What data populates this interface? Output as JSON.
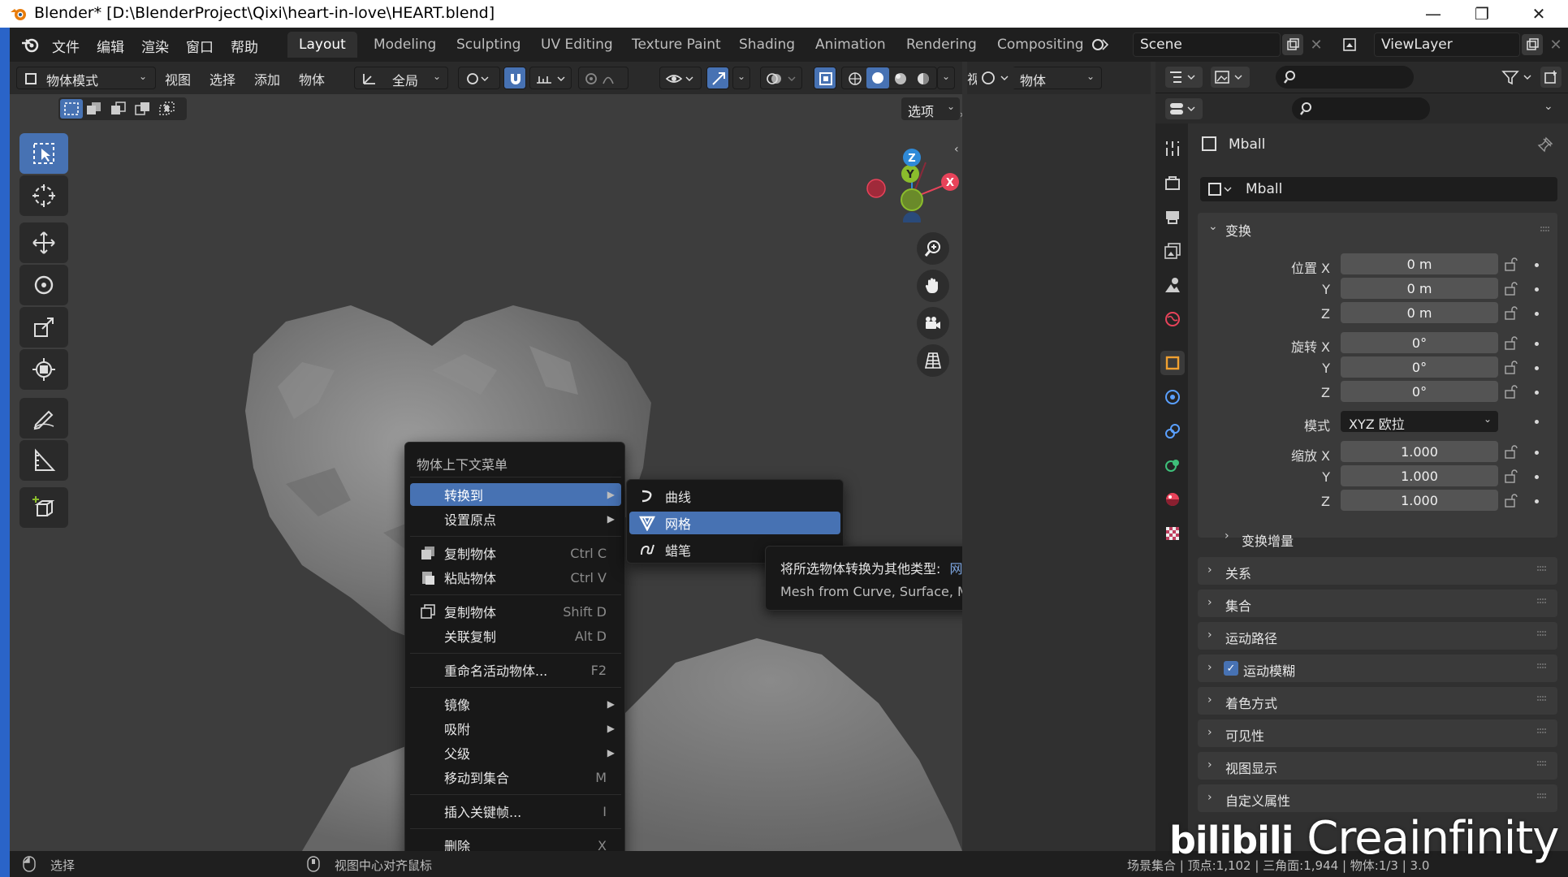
{
  "window": {
    "title": "Blender* [D:\\BlenderProject\\Qixi\\heart-in-love\\HEART.blend]",
    "minimize": "—",
    "maximize": "❐",
    "close": "✕"
  },
  "menu": {
    "items": [
      "文件",
      "编辑",
      "渲染",
      "窗口",
      "帮助"
    ]
  },
  "workspaces": [
    "Layout",
    "Modeling",
    "Sculpting",
    "UV Editing",
    "Texture Paint",
    "Shading",
    "Animation",
    "Rendering",
    "Compositing"
  ],
  "scene": {
    "name": "Scene",
    "view_layer": "ViewLayer"
  },
  "viewport_header": {
    "mode": "物体模式",
    "menus": [
      "视图",
      "选择",
      "添加",
      "物体"
    ],
    "transform_orientation": "全局",
    "object_type_label": "物体",
    "view_label": "视图",
    "options": "选项"
  },
  "gizmo": {
    "z": "Z",
    "x": "X",
    "y": "Y"
  },
  "context_menu": {
    "title": "物体上下文菜单",
    "items": [
      {
        "label": "转换到",
        "shortcut": "",
        "submenu": true
      },
      {
        "label": "设置原点",
        "shortcut": "",
        "submenu": true
      },
      {
        "label": "复制物体",
        "shortcut": "Ctrl C",
        "submenu": false
      },
      {
        "label": "粘贴物体",
        "shortcut": "Ctrl V",
        "submenu": false
      },
      {
        "label": "复制物体",
        "shortcut": "Shift D",
        "submenu": false
      },
      {
        "label": "关联复制",
        "shortcut": "Alt D",
        "submenu": false
      },
      {
        "label": "重命名活动物体...",
        "shortcut": "F2",
        "submenu": false
      },
      {
        "label": "镜像",
        "shortcut": "",
        "submenu": true
      },
      {
        "label": "吸附",
        "shortcut": "",
        "submenu": true
      },
      {
        "label": "父级",
        "shortcut": "",
        "submenu": true
      },
      {
        "label": "移动到集合",
        "shortcut": "M",
        "submenu": false
      },
      {
        "label": "插入关键帧...",
        "shortcut": "I",
        "submenu": false
      },
      {
        "label": "删除",
        "shortcut": "X",
        "submenu": false
      }
    ],
    "highlighted": "转换到"
  },
  "submenu": {
    "items": [
      "曲线",
      "网格",
      "蜡笔"
    ],
    "highlighted": "网格"
  },
  "tooltip": {
    "prefix": "将所选物体转换为其他类型:",
    "value": "网格",
    "description": "Mesh from Curve, Surface, Metaball, or Text objects"
  },
  "properties": {
    "object_name": "Mball",
    "data_name": "Mball",
    "transform_label": "变换",
    "location": {
      "label": "位置 X",
      "x": "0 m",
      "y": "0 m",
      "z": "0 m"
    },
    "rotation": {
      "label": "旋转 X",
      "x": "0°",
      "y": "0°",
      "z": "0°"
    },
    "rotation_mode_label": "模式",
    "rotation_mode": "XYZ 欧拉",
    "scale": {
      "label": "缩放 X",
      "x": "1.000",
      "y": "1.000",
      "z": "1.000"
    },
    "axis_y": "Y",
    "axis_z": "Z",
    "delta_transform": "变换增量",
    "panels": [
      "关系",
      "集合",
      "运动路径",
      "运动模糊",
      "着色方式",
      "可见性",
      "视图显示",
      "自定义属性"
    ]
  },
  "status": {
    "left": "选择",
    "middle": "视图中心对齐鼠标",
    "right": "场景集合 | 顶点:1,102 | 三角面:1,944 | 物体:1/3 | 3.0"
  },
  "watermark": "Creainfinity",
  "watermark_logo": "bilibili",
  "colors": {
    "accent": "#4772b3",
    "axis_x": "#e8435a",
    "axis_y": "#8bbd2c",
    "axis_z": "#2f8ad8"
  }
}
